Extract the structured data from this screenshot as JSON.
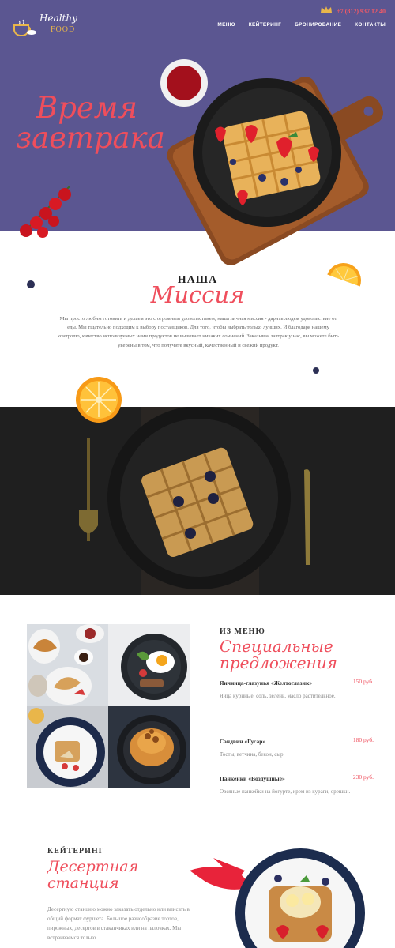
{
  "header": {
    "logo_script": "Healthy",
    "logo_food": "FOOD",
    "phone": "+7 (812) 937 12 40",
    "nav": [
      "МЕНЮ",
      "КЕЙТЕРИНГ",
      "БРОНИРОВАНИЕ",
      "КОНТАКТЫ"
    ]
  },
  "hero": {
    "title_line1": "Время",
    "title_line2": "завтрака"
  },
  "mission": {
    "kicker": "НАША",
    "title": "Миссия",
    "text": "Мы просто любим готовить и делаем это с огромным удовольствием, наша личная миссия - дарить людям удовольствие от еды. Мы тщательно подходим к выбору поставщиков. Для того, чтобы выбрать только лучших. И благодаря нашему контролю, качество используемых нами продуктов не вызывает никаких сомнений. Заказывая завтрак у нас, вы можете быть уверены в том, что получите вкусный, качественный и свежий продукт."
  },
  "menu": {
    "kicker": "ИЗ МЕНЮ",
    "title_line1": "Специальные",
    "title_line2": "предложения",
    "items": [
      {
        "name": "Яичница-глазунья «Желтоглазик»",
        "price": "150 руб.",
        "desc": "Яйца куриные, соль, зелень, масло растительное."
      },
      {
        "name": "Сэндвич «Гусар»",
        "price": "180 руб.",
        "desc": "Тосты, ветчина, бекон, сыр."
      },
      {
        "name": "Панкейки «Воздушные»",
        "price": "230 руб.",
        "desc": "Овсяные панкейки на йогурте, крем из кураги, орешки."
      }
    ]
  },
  "catering": {
    "kicker": "КЕЙТЕРИНГ",
    "title_line1": "Десертная",
    "title_line2": "станция",
    "text": "Десертную станцию можно заказать отдельно или вписать в общий формат фуршета. Большое разнообразие тортов, пирожных, десертов в стаканчиках или на палочках. Мы встраиваемся только"
  },
  "colors": {
    "hero_bg": "#5b5691",
    "accent": "#ef4e5c",
    "gold": "#e9b64a"
  }
}
